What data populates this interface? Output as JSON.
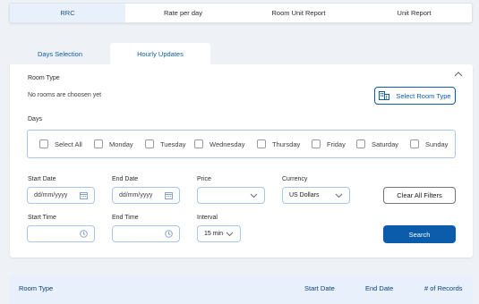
{
  "topnav": {
    "tabs": [
      {
        "label": "RRC"
      },
      {
        "label": "Rate per day"
      },
      {
        "label": "Room Unit Report"
      },
      {
        "label": "Unit Report"
      }
    ]
  },
  "subtabs": {
    "items": [
      {
        "label": "Days Selection"
      },
      {
        "label": "Hourly Updates"
      }
    ]
  },
  "room_type": {
    "label": "Room Type",
    "empty_text": "No rooms are choosen yet",
    "select_button": "Select Room Type",
    "select_icon": "building-icon"
  },
  "days": {
    "label": "Days",
    "items": [
      {
        "label": "Select All",
        "checked": false
      },
      {
        "label": "Monday",
        "checked": false
      },
      {
        "label": "Tuesday",
        "checked": false
      },
      {
        "label": "Wednesday",
        "checked": false
      },
      {
        "label": "Thursday",
        "checked": false
      },
      {
        "label": "Friday",
        "checked": false
      },
      {
        "label": "Saturday",
        "checked": false
      },
      {
        "label": "Sunday",
        "checked": false
      }
    ]
  },
  "filters": {
    "start_date": {
      "label": "Start Date",
      "placeholder": "dd/mm/yyyy"
    },
    "end_date": {
      "label": "End Date",
      "placeholder": "dd/mm/yyyy"
    },
    "price": {
      "label": "Price",
      "value": ""
    },
    "currency": {
      "label": "Currency",
      "value": "US Dollars"
    },
    "clear_button": "Clear All Filters",
    "start_time": {
      "label": "Start Time",
      "value": ""
    },
    "end_time": {
      "label": "End Time",
      "value": ""
    },
    "interval": {
      "label": "Interval",
      "value": "15 min"
    },
    "search_button": "Search"
  },
  "table": {
    "headers": [
      "Room Type",
      "Start Date",
      "End Date",
      "# of Records"
    ]
  },
  "colors": {
    "brand": "#0b5cab",
    "active_tab_bg": "#e8f1fb",
    "page_bg": "#eef1f5"
  }
}
